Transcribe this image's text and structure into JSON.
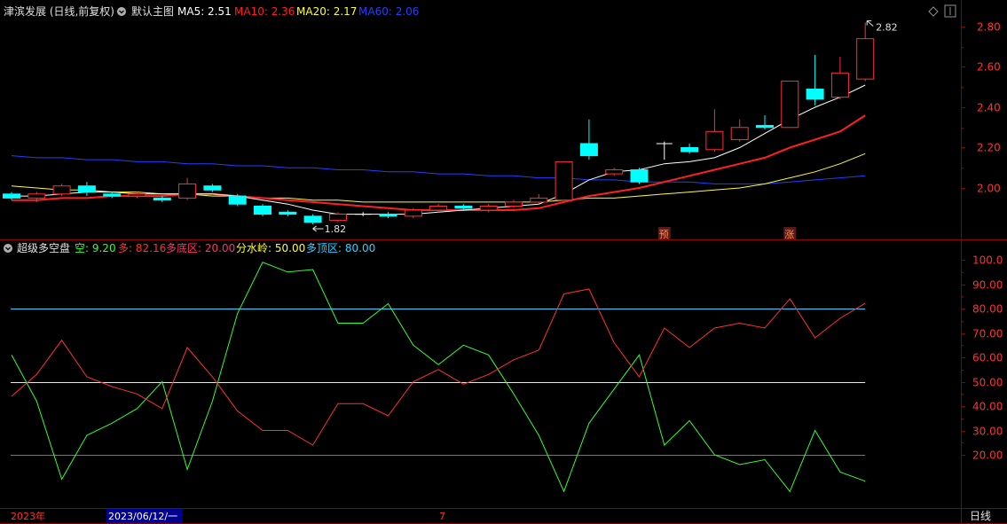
{
  "top_header": {
    "stock": "津滨发展 (日线,前复权)",
    "main_chart": "默认主图",
    "ma": [
      {
        "label": "MA5: 2.51",
        "color": "#ffffff"
      },
      {
        "label": "MA10: 2.36",
        "color": "#ff2020"
      },
      {
        "label": "MA20: 2.17",
        "color": "#ffff30"
      },
      {
        "label": "MA60: 2.06",
        "color": "#2040ff"
      }
    ]
  },
  "bottom_header": {
    "name": "超级多空盘",
    "items": [
      {
        "label": "空: 9.20",
        "color": "#30ff30"
      },
      {
        "label": "多: 82.16",
        "color": "#ff3030"
      },
      {
        "label": "多底区: 20.00",
        "color": "#ff3070"
      },
      {
        "label": "分水岭: 50.00",
        "color": "#ffff30"
      },
      {
        "label": "多顶区: 80.00",
        "color": "#30d0ff"
      }
    ]
  },
  "footer": {
    "year": "2023年",
    "date": "2023/06/12/一",
    "month": "7",
    "period": "日线"
  },
  "colors": {
    "up": "#ff3030",
    "down": "#00ffff",
    "grid": "#8b0000",
    "axis_text": "#ff3030"
  },
  "chart_data": [
    {
      "type": "candlestick",
      "ylim": [
        1.75,
        2.87
      ],
      "y_ticks": [
        "2.00",
        "2.20",
        "2.40",
        "2.60",
        "2.80"
      ],
      "high_label": "2.82",
      "low_label": "1.82",
      "markers": [
        "预",
        "涨"
      ],
      "candles": [
        {
          "o": 1.97,
          "c": 1.95,
          "h": 1.98,
          "l": 1.94
        },
        {
          "o": 1.95,
          "c": 1.97,
          "h": 1.98,
          "l": 1.93
        },
        {
          "o": 1.97,
          "c": 2.01,
          "h": 2.02,
          "l": 1.96
        },
        {
          "o": 2.01,
          "c": 1.98,
          "h": 2.03,
          "l": 1.96
        },
        {
          "o": 1.97,
          "c": 1.96,
          "h": 1.98,
          "l": 1.95
        },
        {
          "o": 1.96,
          "c": 1.97,
          "h": 1.98,
          "l": 1.95
        },
        {
          "o": 1.95,
          "c": 1.94,
          "h": 1.96,
          "l": 1.93
        },
        {
          "o": 1.95,
          "c": 2.02,
          "h": 2.05,
          "l": 1.94
        },
        {
          "o": 2.01,
          "c": 1.99,
          "h": 2.02,
          "l": 1.98
        },
        {
          "o": 1.96,
          "c": 1.92,
          "h": 1.97,
          "l": 1.91
        },
        {
          "o": 1.91,
          "c": 1.87,
          "h": 1.92,
          "l": 1.86
        },
        {
          "o": 1.88,
          "c": 1.87,
          "h": 1.89,
          "l": 1.86
        },
        {
          "o": 1.86,
          "c": 1.83,
          "h": 1.87,
          "l": 1.82
        },
        {
          "o": 1.84,
          "c": 1.87,
          "h": 1.88,
          "l": 1.83
        },
        {
          "o": 1.87,
          "c": 1.87,
          "h": 1.88,
          "l": 1.86
        },
        {
          "o": 1.87,
          "c": 1.86,
          "h": 1.88,
          "l": 1.85
        },
        {
          "o": 1.86,
          "c": 1.89,
          "h": 1.9,
          "l": 1.85
        },
        {
          "o": 1.89,
          "c": 1.91,
          "h": 1.92,
          "l": 1.88
        },
        {
          "o": 1.91,
          "c": 1.9,
          "h": 1.92,
          "l": 1.89
        },
        {
          "o": 1.89,
          "c": 1.91,
          "h": 1.92,
          "l": 1.88
        },
        {
          "o": 1.91,
          "c": 1.93,
          "h": 1.94,
          "l": 1.9
        },
        {
          "o": 1.93,
          "c": 1.95,
          "h": 1.97,
          "l": 1.92
        },
        {
          "o": 1.94,
          "c": 2.13,
          "h": 2.13,
          "l": 1.94
        },
        {
          "o": 2.22,
          "c": 2.16,
          "h": 2.34,
          "l": 2.14
        },
        {
          "o": 2.07,
          "c": 2.09,
          "h": 2.1,
          "l": 2.06
        },
        {
          "o": 2.09,
          "c": 2.03,
          "h": 2.1,
          "l": 2.02
        },
        {
          "o": 2.22,
          "c": 2.22,
          "h": 2.23,
          "l": 2.14
        },
        {
          "o": 2.2,
          "c": 2.18,
          "h": 2.22,
          "l": 2.17
        },
        {
          "o": 2.19,
          "c": 2.28,
          "h": 2.39,
          "l": 2.18
        },
        {
          "o": 2.24,
          "c": 2.3,
          "h": 2.34,
          "l": 2.23
        },
        {
          "o": 2.31,
          "c": 2.3,
          "h": 2.36,
          "l": 2.29
        },
        {
          "o": 2.3,
          "c": 2.53,
          "h": 2.53,
          "l": 2.3
        },
        {
          "o": 2.49,
          "c": 2.44,
          "h": 2.66,
          "l": 2.41
        },
        {
          "o": 2.45,
          "c": 2.57,
          "h": 2.65,
          "l": 2.44
        },
        {
          "o": 2.54,
          "c": 2.74,
          "h": 2.82,
          "l": 2.53
        }
      ],
      "ma5": [
        1.96,
        1.96,
        1.97,
        1.98,
        1.98,
        1.97,
        1.97,
        1.97,
        1.97,
        1.96,
        1.94,
        1.92,
        1.89,
        1.87,
        1.87,
        1.87,
        1.87,
        1.88,
        1.89,
        1.9,
        1.91,
        1.92,
        1.97,
        2.04,
        2.08,
        2.09,
        2.12,
        2.13,
        2.15,
        2.2,
        2.27,
        2.34,
        2.4,
        2.45,
        2.51
      ],
      "ma10": [
        1.94,
        1.94,
        1.95,
        1.95,
        1.96,
        1.96,
        1.96,
        1.97,
        1.97,
        1.96,
        1.95,
        1.94,
        1.93,
        1.92,
        1.91,
        1.9,
        1.89,
        1.89,
        1.89,
        1.89,
        1.89,
        1.9,
        1.93,
        1.96,
        1.98,
        2.0,
        2.03,
        2.06,
        2.09,
        2.12,
        2.15,
        2.2,
        2.24,
        2.28,
        2.36
      ],
      "ma20": [
        2.01,
        2.0,
        1.99,
        1.99,
        1.98,
        1.98,
        1.97,
        1.97,
        1.96,
        1.96,
        1.95,
        1.95,
        1.94,
        1.94,
        1.93,
        1.93,
        1.93,
        1.93,
        1.93,
        1.93,
        1.93,
        1.93,
        1.94,
        1.95,
        1.95,
        1.96,
        1.97,
        1.98,
        1.99,
        2.0,
        2.02,
        2.05,
        2.08,
        2.12,
        2.17
      ],
      "ma60": [
        2.16,
        2.15,
        2.15,
        2.14,
        2.14,
        2.13,
        2.13,
        2.12,
        2.12,
        2.11,
        2.11,
        2.1,
        2.1,
        2.09,
        2.09,
        2.08,
        2.08,
        2.07,
        2.07,
        2.06,
        2.06,
        2.05,
        2.05,
        2.04,
        2.04,
        2.03,
        2.03,
        2.03,
        2.02,
        2.02,
        2.02,
        2.03,
        2.04,
        2.05,
        2.06
      ]
    },
    {
      "type": "line",
      "ylim": [
        0,
        105
      ],
      "y_ticks": [
        "20.00",
        "30.00",
        "40.00",
        "50.00",
        "60.00",
        "70.00",
        "80.00",
        "90.00",
        "100.0"
      ],
      "series": [
        {
          "name": "空",
          "color": "#30ff30",
          "values": [
            61,
            42,
            10,
            28,
            33,
            39,
            50,
            14,
            42,
            78,
            99,
            95,
            96,
            74,
            74,
            82,
            65,
            57,
            65,
            61,
            45,
            28,
            5,
            33,
            47,
            61,
            24,
            34,
            20,
            16,
            18,
            5,
            30,
            13,
            9.2
          ]
        },
        {
          "name": "多",
          "color": "#ff3030",
          "values": [
            44,
            53,
            67,
            52,
            48,
            45,
            39,
            64,
            52,
            38,
            30,
            30,
            24,
            41,
            41,
            36,
            50,
            55,
            49,
            53,
            59,
            63,
            86,
            88,
            66,
            52,
            72,
            64,
            72,
            74,
            72,
            84,
            68,
            76,
            82.16
          ]
        }
      ],
      "levels": [
        {
          "name": "多底区",
          "value": 20,
          "color": "#ff3070"
        },
        {
          "name": "分水岭",
          "value": 50,
          "color": "#ffff30"
        },
        {
          "name": "多顶区",
          "value": 80,
          "color": "#30d0ff"
        }
      ]
    }
  ]
}
